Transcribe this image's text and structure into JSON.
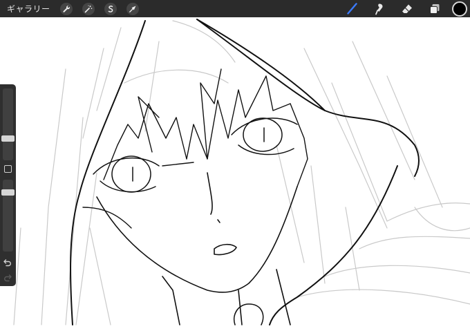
{
  "toolbar": {
    "gallery_label": "ギャラリー",
    "left_tools": [
      "wrench-icon",
      "magic-wand-icon",
      "selection-s-icon",
      "transform-arrow-icon"
    ],
    "right_tools": [
      "brush-icon",
      "smudge-icon",
      "eraser-icon",
      "layers-icon"
    ],
    "accent_color": "#3b7bff",
    "current_color": "#000000"
  },
  "sidebar": {
    "size_slider": 0.28,
    "opacity_slider": 0.85
  },
  "canvas": {
    "background": "#ffffff"
  }
}
